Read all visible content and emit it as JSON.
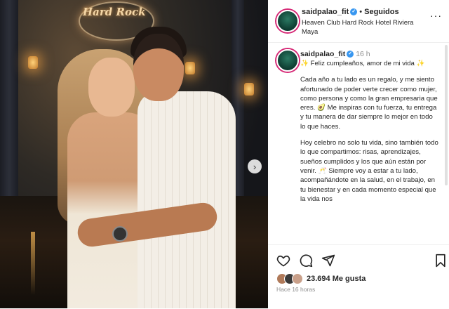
{
  "photo": {
    "sign_text": "Hard Rock",
    "next_glyph": "›"
  },
  "header": {
    "username": "saidpalao_fit",
    "separator": "•",
    "follow_status": "Seguidos",
    "location": "Heaven Club Hard Rock Hotel Riviera Maya",
    "more_glyph": "···"
  },
  "caption": {
    "username": "saidpalao_fit",
    "time": "16 h",
    "paragraphs": [
      "✨ Feliz cumpleaños, amor de mi vida ✨",
      "Cada año a tu lado es un regalo, y me siento afortunado de poder verte crecer como mujer, como persona y como la gran empresaria que eres. 🥑 Me inspiras con tu fuerza, tu entrega y tu manera de dar siempre lo mejor en todo lo que haces.",
      "Hoy celebro no solo tu vida, sino también todo lo que compartimos: risas, aprendizajes, sueños cumplidos y los que aún están por venir. 🥂 Siempre voy a estar a tu lado, acompañándote en la salud, en el trabajo, en tu bienestar y en cada momento especial que la vida nos"
    ]
  },
  "actions": {
    "icons": [
      "heart-icon",
      "comment-icon",
      "share-icon",
      "bookmark-icon"
    ],
    "likes": "23.694 Me gusta",
    "time_ago": "Hace 16 horas"
  },
  "colors": {
    "verified": "#3897f0",
    "story_ring": "#d62976",
    "muted": "#8e8e8e",
    "text": "#262626"
  }
}
